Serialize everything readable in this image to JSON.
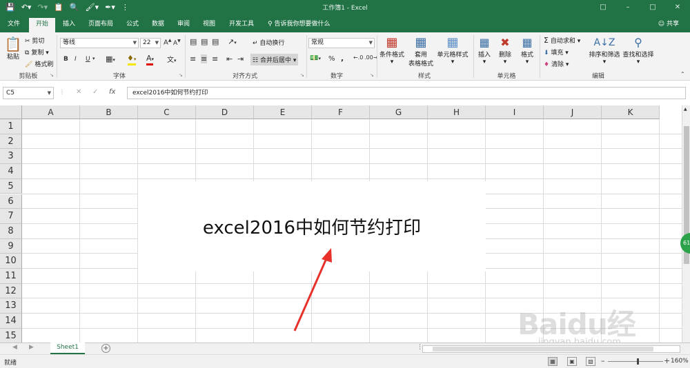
{
  "window": {
    "title": "工作簿1 - Excel",
    "controls": [
      "□",
      "–",
      "□",
      "✕"
    ]
  },
  "tabs": [
    "文件",
    "开始",
    "插入",
    "页面布局",
    "公式",
    "数据",
    "审阅",
    "视图",
    "开发工具"
  ],
  "active_tab": "开始",
  "tellme": "告诉我你想要做什么",
  "share": "共享",
  "ribbon": {
    "clipboard": {
      "paste": "粘贴",
      "cut": "剪切",
      "copy": "复制",
      "format_painter": "格式刷",
      "label": "剪贴板"
    },
    "font": {
      "name": "等线",
      "size": "22",
      "bold": "B",
      "italic": "I",
      "underline": "U",
      "label": "字体"
    },
    "alignment": {
      "wrap": "自动换行",
      "merge": "合并后居中",
      "label": "对齐方式"
    },
    "number": {
      "format": "常规",
      "percent": "%",
      "comma": ",",
      "label": "数字"
    },
    "styles": {
      "conditional": "条件格式",
      "table_line1": "套用",
      "table_line2": "表格格式",
      "cell_styles": "单元格样式",
      "label": "样式"
    },
    "cells": {
      "insert": "插入",
      "delete": "删除",
      "format": "格式",
      "label": "单元格"
    },
    "editing": {
      "autosum": "自动求和",
      "fill": "填充",
      "clear": "清除",
      "sort": "排序和筛选",
      "find": "查找和选择",
      "label": "编辑"
    }
  },
  "formula_bar": {
    "name_box": "C5",
    "fx": "fx",
    "content": "excel2016中如何节约打印"
  },
  "columns": [
    "A",
    "B",
    "C",
    "D",
    "E",
    "F",
    "G",
    "H",
    "I",
    "J",
    "K"
  ],
  "rows": [
    "1",
    "2",
    "3",
    "4",
    "5",
    "6",
    "7",
    "8",
    "9",
    "10",
    "11",
    "12",
    "13",
    "14",
    "15"
  ],
  "cell_text": "excel2016中如何节约打印",
  "green_badge": "61",
  "sheet_tab": "Sheet1",
  "add_sheet": "+",
  "status": "就绪",
  "zoom": "160%",
  "watermark": {
    "logo": "Baidu经验",
    "url": "jingyan.baidu.com"
  }
}
